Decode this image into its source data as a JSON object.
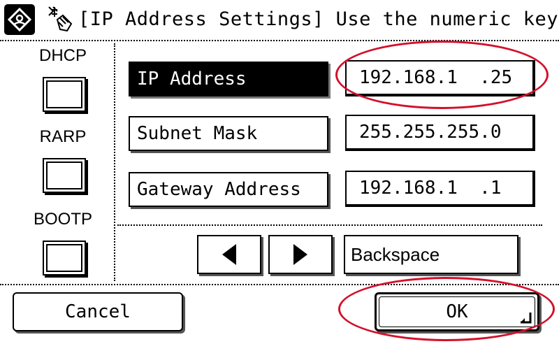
{
  "title": {
    "text": "[IP Address Settings] Use the numeric keys.",
    "home_icon": "home-menu-icon",
    "title_icon": "hand-press-icon"
  },
  "protocols": {
    "items": [
      {
        "label": "DHCP"
      },
      {
        "label": "RARP"
      },
      {
        "label": "BOOTP"
      }
    ]
  },
  "fields": [
    {
      "label": "IP Address",
      "value": "192.168.1  .25",
      "selected": true
    },
    {
      "label": "Subnet Mask",
      "value": "255.255.255.0",
      "selected": false
    },
    {
      "label": "Gateway Address",
      "value": "192.168.1  .1",
      "selected": false
    }
  ],
  "navigation": {
    "left_icon": "triangle-left-icon",
    "right_icon": "triangle-right-icon",
    "backspace_label": "Backspace"
  },
  "footer": {
    "cancel_label": "Cancel",
    "ok_label": "OK"
  },
  "colors": {
    "annotation": "#d3102b",
    "selected_bg": "#000000"
  }
}
